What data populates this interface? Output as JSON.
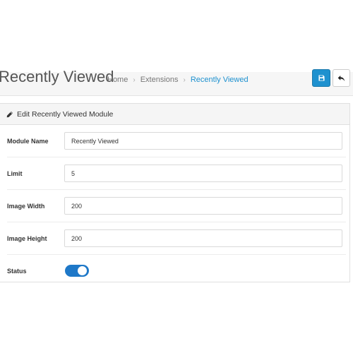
{
  "header": {
    "title": "Recently Viewed",
    "breadcrumb": [
      {
        "label": "Home"
      },
      {
        "label": "Extensions"
      },
      {
        "label": "Recently Viewed"
      }
    ],
    "save_icon": "floppy-disk-icon",
    "back_icon": "reply-arrow-icon"
  },
  "panel": {
    "title": "Edit Recently Viewed Module",
    "title_icon": "pencil-icon"
  },
  "form": {
    "module_name": {
      "label": "Module Name",
      "value": "Recently Viewed"
    },
    "limit": {
      "label": "Limit",
      "value": "5"
    },
    "image_width": {
      "label": "Image Width",
      "value": "200"
    },
    "image_height": {
      "label": "Image Height",
      "value": "200"
    },
    "status": {
      "label": "Status",
      "enabled": true
    }
  },
  "colors": {
    "accent": "#1e91cf",
    "toggle_on": "#1e78c8"
  }
}
